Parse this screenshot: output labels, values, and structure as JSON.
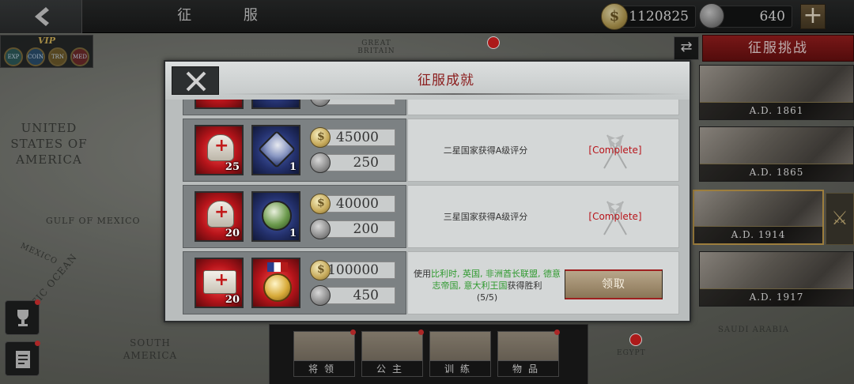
{
  "header": {
    "title": "征  服",
    "gold": "1120825",
    "gems": "640"
  },
  "vip": {
    "label": "VIP",
    "badges": [
      "EXP",
      "COIN",
      "TRN",
      "MED"
    ]
  },
  "map": {
    "usa": "UNITED STATES OF AMERICA",
    "gulf": "GULF OF MEXICO",
    "mexico": "MEXICO",
    "pacific": "PACIFIC OCEAN",
    "south_america": "SOUTH AMERICA",
    "great_britain": "GREAT BRITAIN",
    "egypt": "EGYPT",
    "saudi": "SAUDI ARABIA"
  },
  "challenge": {
    "title": "征服挑战",
    "eras": [
      "A.D. 1861",
      "A.D. 1865",
      "A.D. 1914",
      "A.D. 1917"
    ]
  },
  "bottom_tabs": [
    "将领",
    "公主",
    "训练",
    "物品"
  ],
  "modal": {
    "title": "征服成就",
    "rows": [
      {
        "item1_count": "25",
        "item2_count": "1",
        "gold": "45000",
        "stone": "250",
        "desc": "二星国家获得A级评分",
        "status": "[Complete]"
      },
      {
        "item1_count": "20",
        "item2_count": "1",
        "gold": "40000",
        "stone": "200",
        "desc": "三星国家获得A级评分",
        "status": "[Complete]"
      },
      {
        "item1_count": "20",
        "gold": "100000",
        "stone": "450",
        "desc_prefix": "使用",
        "desc_countries": "比利时, 英国, 非洲酋长联盟, 德意志帝国, 意大利王国",
        "desc_suffix": "获得胜利",
        "progress": "(5/5)",
        "claim": "领取"
      }
    ]
  },
  "colors": {
    "accent_red": "#8a1b1b",
    "complete_red": "#b8141a",
    "highlight_green": "#2f9a2f"
  }
}
